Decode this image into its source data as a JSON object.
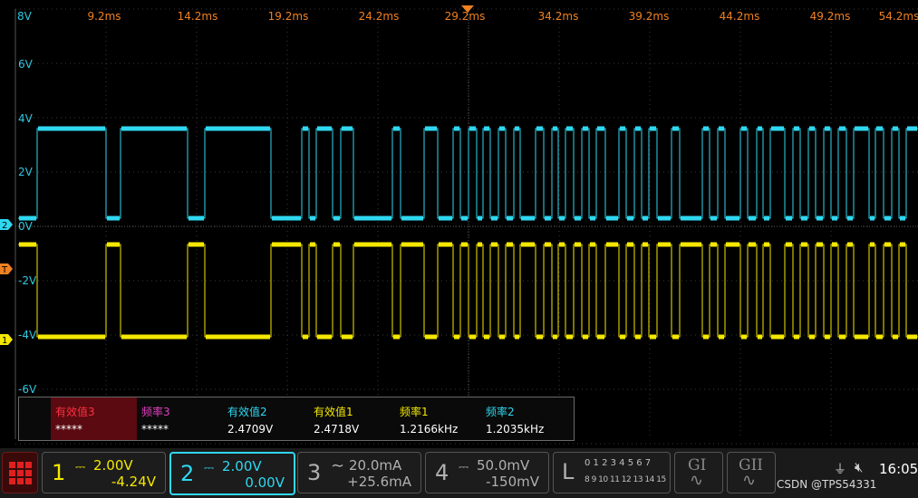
{
  "time_axis": {
    "labels": [
      "9.2ms",
      "14.2ms",
      "19.2ms",
      "24.2ms",
      "29.2ms",
      "34.2ms",
      "39.2ms",
      "44.2ms",
      "49.2ms",
      "54.2ms"
    ],
    "clipped_left": "8V"
  },
  "volt_axis": {
    "labels": [
      "6V",
      "4V",
      "2V",
      "0V",
      "-2V",
      "-4V",
      "-6V"
    ]
  },
  "markers": {
    "ch2": "2",
    "trigger": "T",
    "ch1": "1"
  },
  "colors": {
    "ch1": "#f4e800",
    "ch2": "#2fd8f0",
    "ch3": "#b0b0b0",
    "ch4": "#b0b0b0",
    "time": "#f08020",
    "magenta": "#e040c0"
  },
  "measurements": [
    {
      "label": "有效值3",
      "value": "*****"
    },
    {
      "label": "频率3",
      "value": "*****"
    },
    {
      "label": "有效值2",
      "value": "2.4709V"
    },
    {
      "label": "有效值1",
      "value": "2.4718V"
    },
    {
      "label": "频率1",
      "value": "1.2166kHz"
    },
    {
      "label": "频率2",
      "value": "1.2035kHz"
    }
  ],
  "channels": [
    {
      "num": "1",
      "scale": "2.00V",
      "offset": "-4.24V"
    },
    {
      "num": "2",
      "scale": "2.00V",
      "offset": "0.00V"
    },
    {
      "num": "3",
      "scale": "20.0mA",
      "offset": "+25.6mA"
    },
    {
      "num": "4",
      "scale": "50.0mV",
      "offset": "-150mV"
    }
  ],
  "logic": {
    "label": "L",
    "row1": "0 1 2 3  4 5 6 7",
    "row2": "8 9 10 11 12 13 14 15"
  },
  "gen1": "GI",
  "gen2": "GII",
  "status": {
    "watermark": "CSDN @TPS54331",
    "time": "16:05"
  }
}
